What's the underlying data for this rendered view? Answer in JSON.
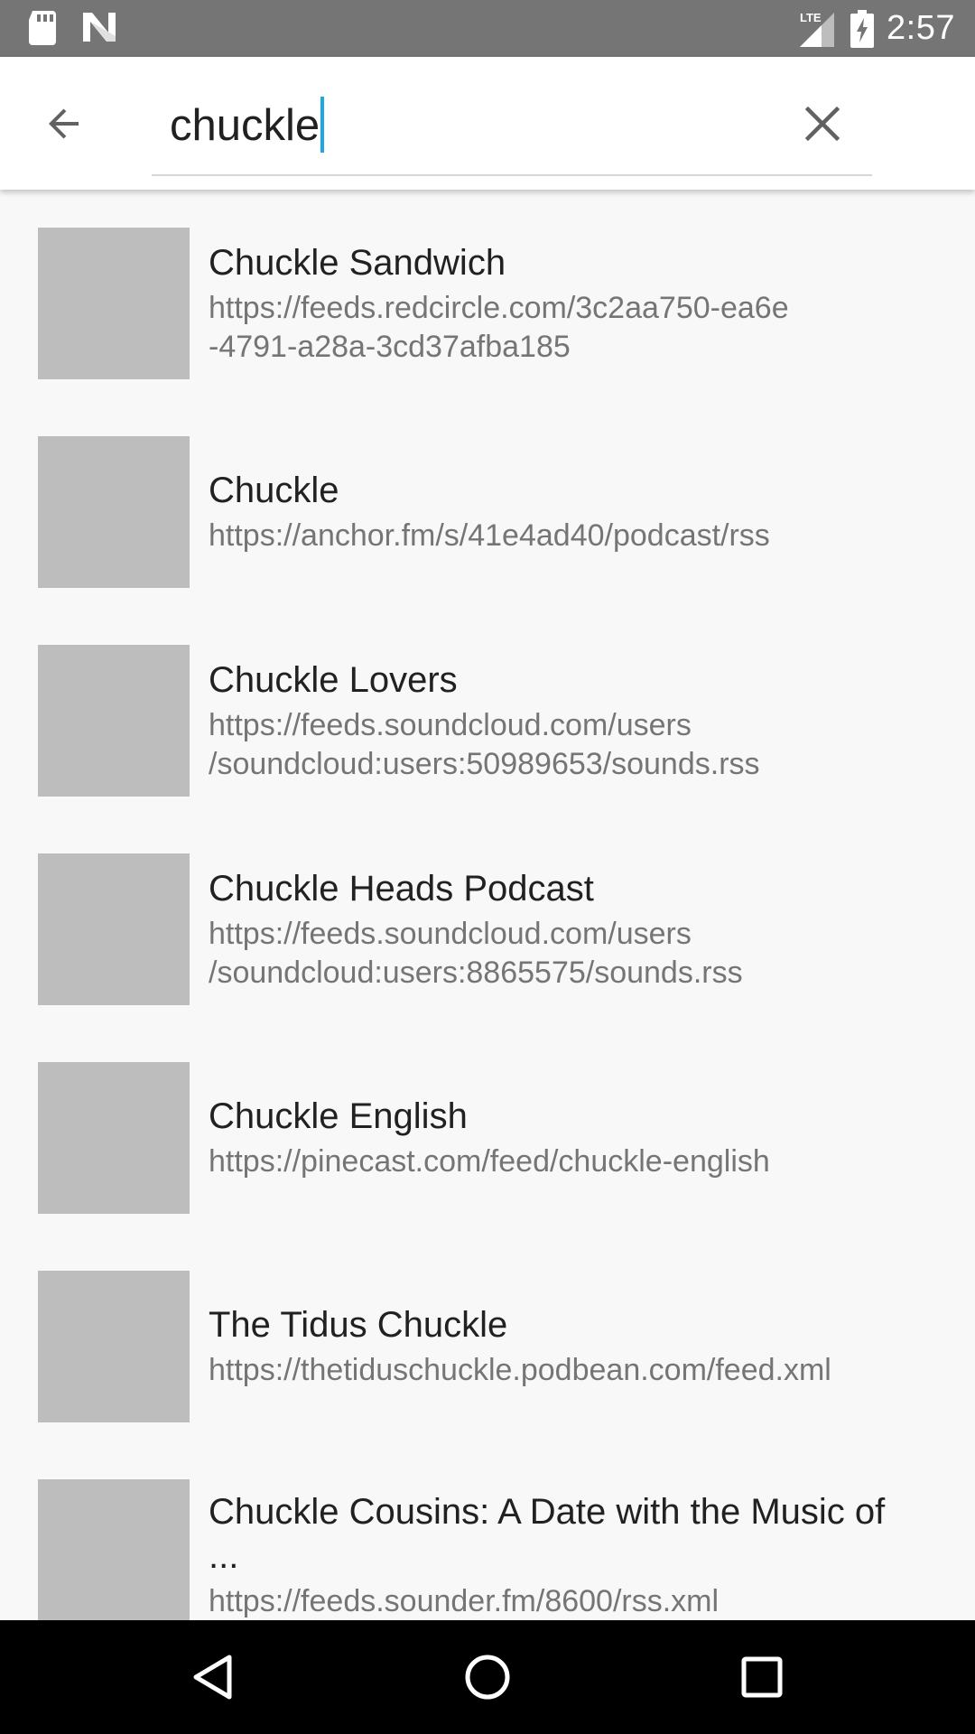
{
  "status_bar": {
    "time": "2:57",
    "network": "LTE",
    "left_icons": [
      "sd-card-icon",
      "n-logo-icon"
    ],
    "right_icons": [
      "lte-signal-icon",
      "battery-charging-icon"
    ]
  },
  "search": {
    "query": "chuckle",
    "back_icon": "arrow-back-icon",
    "clear_icon": "close-icon",
    "caret_color": "#1ea7e4"
  },
  "results": [
    {
      "title": "Chuckle Sandwich",
      "url_lines": [
        "https://feeds.redcircle.com/3c2aa750-ea6e",
        "-4791-a28a-3cd37afba185"
      ]
    },
    {
      "title": "Chuckle",
      "url_lines": [
        "https://anchor.fm/s/41e4ad40/podcast/rss"
      ]
    },
    {
      "title": "Chuckle Lovers",
      "url_lines": [
        "https://feeds.soundcloud.com/users",
        "/soundcloud:users:50989653/sounds.rss"
      ]
    },
    {
      "title": "Chuckle Heads Podcast",
      "url_lines": [
        "https://feeds.soundcloud.com/users",
        "/soundcloud:users:8865575/sounds.rss"
      ]
    },
    {
      "title": "Chuckle English",
      "url_lines": [
        "https://pinecast.com/feed/chuckle-english"
      ]
    },
    {
      "title": "The Tidus Chuckle",
      "url_lines": [
        "https://thetiduschuckle.podbean.com/feed.xml"
      ]
    },
    {
      "title": "Chuckle Cousins: A Date with the Music of ...",
      "url_lines": [
        "https://feeds.sounder.fm/8600/rss.xml"
      ]
    }
  ],
  "nav_bar": {
    "buttons": [
      "back-triangle-icon",
      "home-circle-icon",
      "recents-square-icon"
    ]
  },
  "colors": {
    "status_bar": "#757575",
    "app_bar": "#ffffff",
    "background": "#f8f8f8",
    "thumbnail_placeholder": "#bdbdbd",
    "title_text": "#212121",
    "url_text": "#757575",
    "nav_bar": "#000000"
  }
}
